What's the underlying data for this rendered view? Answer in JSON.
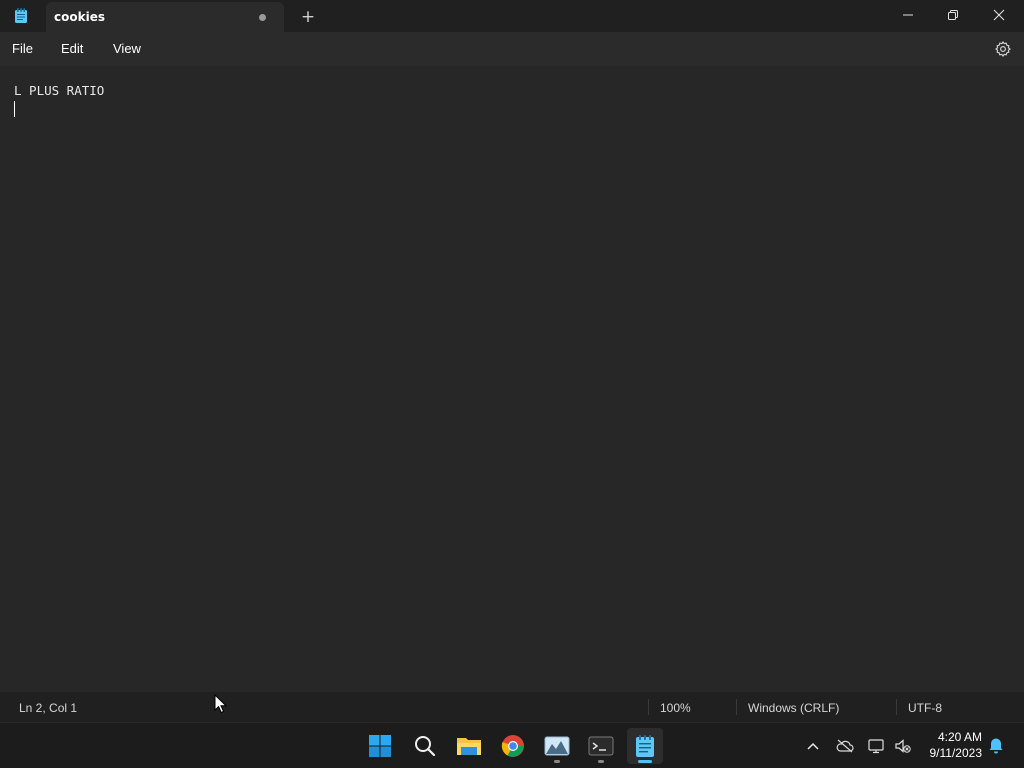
{
  "window": {
    "tab_title": "cookies",
    "new_tab_label": "+",
    "unsaved": true
  },
  "menu": {
    "file": "File",
    "edit": "Edit",
    "view": "View"
  },
  "editor": {
    "line1": "L PLUS RATIO",
    "line2": ""
  },
  "status": {
    "position": "Ln 2, Col 1",
    "zoom": "100%",
    "line_ending": "Windows (CRLF)",
    "encoding": "UTF-8"
  },
  "taskbar": {
    "apps": [
      "start-icon",
      "search-icon",
      "file-explorer-icon",
      "chrome-icon",
      "photos-icon",
      "terminal-icon",
      "notepad-icon"
    ],
    "active_app": "notepad-icon",
    "time": "4:20 AM",
    "date": "9/11/2023"
  },
  "colors": {
    "accent": "#4cc2ff",
    "editor_bg": "#272727",
    "chrome_bg": "#202020"
  }
}
